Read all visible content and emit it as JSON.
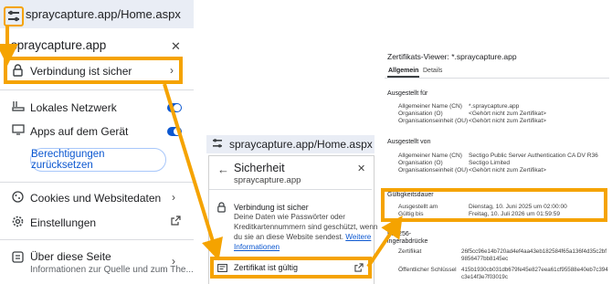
{
  "colors": {
    "accent_orange": "#f5a300",
    "link_blue": "#0b57d0",
    "toggle_blue": "#0b57d0"
  },
  "panel1": {
    "url": "spraycapture.app/Home.aspx",
    "title": "spraycapture.app",
    "close_icon": "close-icon",
    "connection_label": "Verbindung ist sicher",
    "local_network_label": "Lokales Netzwerk",
    "device_apps_label": "Apps auf dem Gerät",
    "reset_button": "Berechtigungen zurücksetzen",
    "cookies_label": "Cookies und Websitedaten",
    "settings_label": "Einstellungen",
    "about_label": "Über diese Seite",
    "about_sub": "Informationen zur Quelle und zum The..."
  },
  "panel2": {
    "url": "spraycapture.app/Home.aspx",
    "title": "Sicherheit",
    "subtitle": "spraycapture.app",
    "secure_title": "Verbindung ist sicher",
    "secure_text_1": "Deine Daten wie Passwörter oder",
    "secure_text_2": "Kreditkartennummern sind geschützt, wenn",
    "secure_text_3": "du sie an diese Website sendest.",
    "more_link_1": "Weitere",
    "more_link_2": "Informationen",
    "cert_label": "Zertifikat ist gültig"
  },
  "panel3": {
    "title": "Zertifikats-Viewer: *.spraycapture.app",
    "tabs": [
      "Allgemein",
      "Details"
    ],
    "issued_for_heading": "Ausgestellt für",
    "issued_for_rows": [
      {
        "label": "Allgemeiner Name (CN)",
        "value": "*.spraycapture.app"
      },
      {
        "label": "Organisation (O)",
        "value": "<Gehört nicht zum Zertifikat>"
      },
      {
        "label": "Organisationseinheit (OU)",
        "value": "<Gehört nicht zum Zertifikat>"
      }
    ],
    "issued_by_heading": "Ausgestellt von",
    "issued_by_rows": [
      {
        "label": "Allgemeiner Name (CN)",
        "value": "Sectigo Public Server Authentication CA DV R36"
      },
      {
        "label": "Organisation (O)",
        "value": "Sectigo Limited"
      },
      {
        "label": "Organisationseinheit (OU)",
        "value": "<Gehört nicht zum Zertifikat>"
      }
    ],
    "validity_heading": "Gültigkeitsdauer",
    "validity_rows": [
      {
        "label": "Ausgestellt am",
        "value": "Dienstag, 10. Juni 2025 um 02:00:00"
      },
      {
        "label": "Gültig bis",
        "value": "Freitag, 10. Juli 2026 um 01:59:59"
      }
    ],
    "fingerprint_heading_1": "HA-256-",
    "fingerprint_heading_2": "ingerabdrücke",
    "fingerprint_rows": [
      {
        "label": "Zertifikat",
        "value_1": "26f5cc96e14b720ad4ef4aa43eb182584f65a136f4d35c2bf",
        "value_2": "9856477bb8145ec"
      },
      {
        "label": "Öffentlicher Schlüssel",
        "value_1": "415b1930cb031db679fe45e827eea61cf95588e40eb7c394",
        "value_2": "c3e14f3e7f03019c"
      }
    ]
  }
}
